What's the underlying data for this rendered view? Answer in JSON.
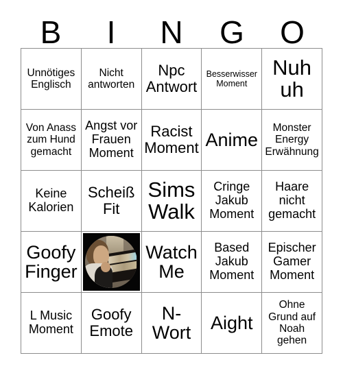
{
  "card": {
    "header_letters": [
      "B",
      "I",
      "N",
      "G",
      "O"
    ],
    "rows": [
      [
        {
          "text": "Unnötiges Englisch",
          "size": "sz-s"
        },
        {
          "text": "Nicht antworten",
          "size": "sz-s"
        },
        {
          "text": "Npc Antwort",
          "size": "sz-l"
        },
        {
          "text": "Besserwisser Moment",
          "size": "sz-xs"
        },
        {
          "text": "Nuh uh",
          "size": "sz-xxl"
        }
      ],
      [
        {
          "text": "Von Anass zum Hund gemacht",
          "size": "sz-s"
        },
        {
          "text": "Angst vor Frauen Moment",
          "size": "sz-m"
        },
        {
          "text": "Racist Moment",
          "size": "sz-l"
        },
        {
          "text": "Anime",
          "size": "sz-xl"
        },
        {
          "text": "Monster Energy Erwähnung",
          "size": "sz-s"
        }
      ],
      [
        {
          "text": "Keine Kalorien",
          "size": "sz-m"
        },
        {
          "text": "Scheiß Fit",
          "size": "sz-l"
        },
        {
          "text": "Sims Walk",
          "size": "sz-xxl"
        },
        {
          "text": "Cringe Jakub Moment",
          "size": "sz-m"
        },
        {
          "text": "Haare nicht gemacht",
          "size": "sz-m"
        }
      ],
      [
        {
          "text": "Goofy Finger",
          "size": "sz-xl"
        },
        {
          "image": "person-at-display-case-photo"
        },
        {
          "text": "Watch Me",
          "size": "sz-xl"
        },
        {
          "text": "Based Jakub Moment",
          "size": "sz-m"
        },
        {
          "text": "Epischer Gamer Moment",
          "size": "sz-m"
        }
      ],
      [
        {
          "text": "L Music Moment",
          "size": "sz-m"
        },
        {
          "text": "Goofy Emote",
          "size": "sz-l"
        },
        {
          "text": "N- Wort",
          "size": "sz-xl"
        },
        {
          "text": "Aight",
          "size": "sz-xl"
        },
        {
          "text": "Ohne Grund auf Noah gehen",
          "size": "sz-s"
        }
      ]
    ]
  },
  "colors": {
    "background": "#ffffff",
    "text": "#000000",
    "grid_line": "#8c8c8c",
    "photo_backdrop": "#050505"
  }
}
